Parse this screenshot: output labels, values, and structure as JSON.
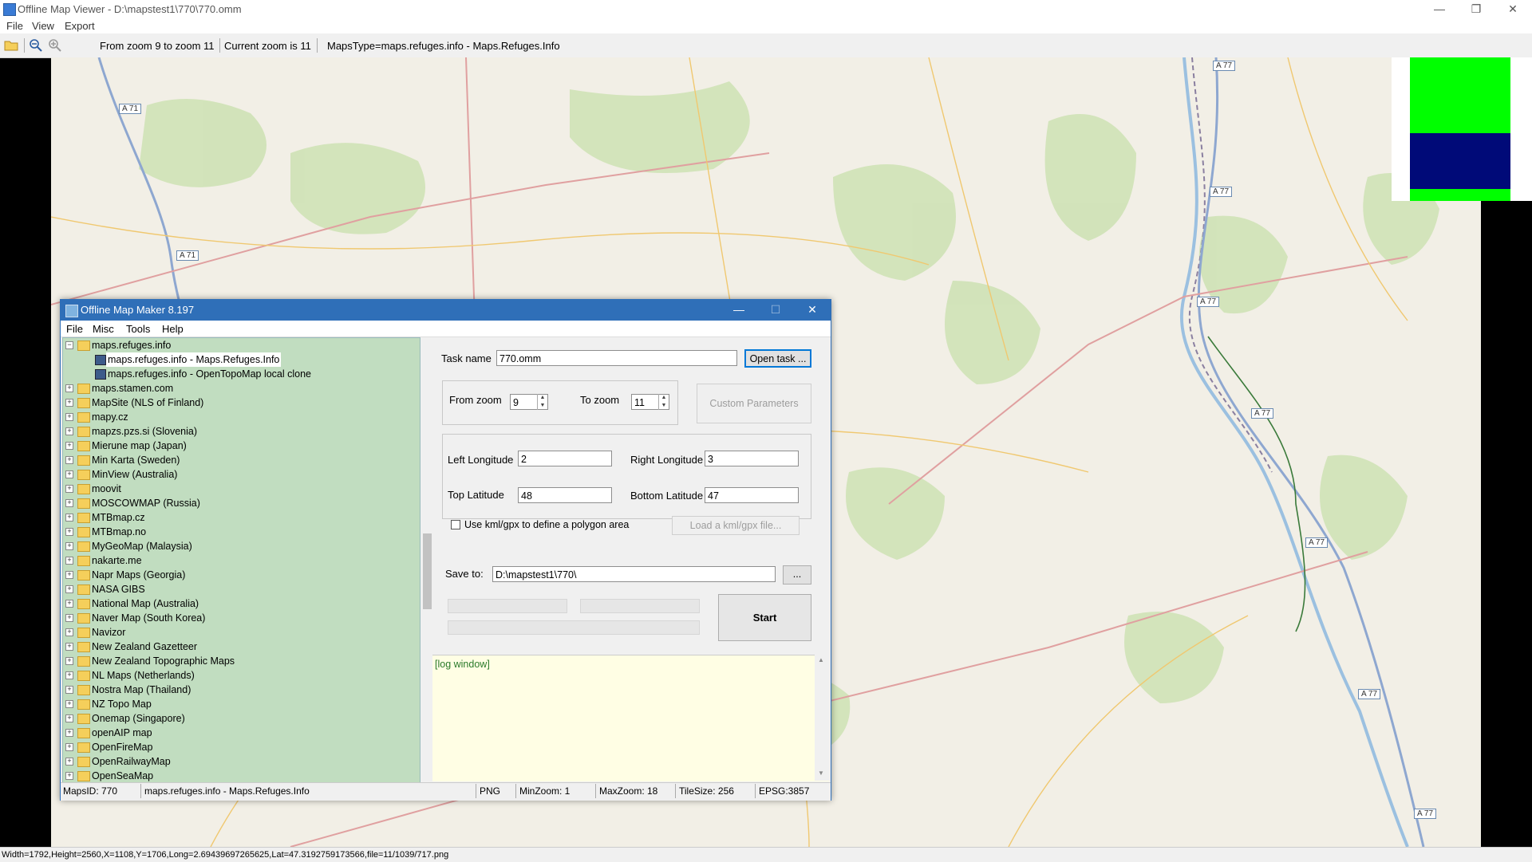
{
  "main_window": {
    "title": "Offline Map Viewer - D:\\mapstest1\\770\\770.omm",
    "controls": {
      "minimize": "—",
      "maximize": "❐",
      "close": "✕"
    }
  },
  "menu": {
    "file": "File",
    "view": "View",
    "export": "Export"
  },
  "toolbar": {
    "icons": [
      "open-folder-icon",
      "zoom-out-icon",
      "zoom-in-icon"
    ],
    "zoom_range": "From zoom 9 to zoom 11",
    "current_zoom": "Current zoom is 11",
    "maps_type": "MapsType=maps.refuges.info - Maps.Refuges.Info"
  },
  "map": {
    "road_labels": [
      "A 71",
      "A 71",
      "A 77",
      "A 77",
      "A 77",
      "A 77",
      "A 77",
      "A 77",
      "A 77"
    ],
    "legend_colors": [
      "#00ff00",
      "#000a78",
      "#00ff00"
    ]
  },
  "status_bar": {
    "text": "Width=1792,Height=2560,X=1108,Y=1706,Long=2.69439697265625,Lat=47.3192759173566,file=11/1039/717.png"
  },
  "dialog": {
    "title": "Offline Map Maker 8.197",
    "controls": {
      "minimize": "—",
      "maximize": "☐",
      "close": "✕"
    },
    "menu": {
      "file": "File",
      "misc": "Misc",
      "tools": "Tools",
      "help": "Help"
    },
    "tree": {
      "root": "maps.refuges.info",
      "children": [
        "maps.refuges.info - Maps.Refuges.Info",
        "maps.refuges.info - OpenTopoMap local clone"
      ],
      "selected_child": 0,
      "folders": [
        "maps.stamen.com",
        "MapSite (NLS of Finland)",
        "mapy.cz",
        "mapzs.pzs.si (Slovenia)",
        "Mierune map (Japan)",
        "Min Karta (Sweden)",
        "MinView (Australia)",
        "moovit",
        "MOSCOWMAP (Russia)",
        "MTBmap.cz",
        "MTBmap.no",
        "MyGeoMap (Malaysia)",
        "nakarte.me",
        "Napr Maps (Georgia)",
        "NASA GIBS",
        "National Map (Australia)",
        "Naver Map (South Korea)",
        "Navizor",
        "New Zealand Gazetteer",
        "New Zealand Topographic Maps",
        "NL Maps (Netherlands)",
        "Nostra Map (Thailand)",
        "NZ Topo Map",
        "Onemap (Singapore)",
        "openAIP map",
        "OpenFireMap",
        "OpenRailwayMap",
        "OpenSeaMap"
      ]
    },
    "task_name_label": "Task name",
    "task_name_value": "770.omm",
    "open_task_button": "Open task ...",
    "from_zoom_label": "From zoom",
    "from_zoom_value": "9",
    "to_zoom_label": "To zoom",
    "to_zoom_value": "11",
    "custom_parameters_button": "Custom Parameters",
    "left_longitude_label": "Left Longitude",
    "left_longitude_value": "2",
    "right_longitude_label": "Right Longitude",
    "right_longitude_value": "3",
    "top_latitude_label": "Top Latitude",
    "top_latitude_value": "48",
    "bottom_latitude_label": "Bottom Latitude",
    "bottom_latitude_value": "47",
    "kml_checkbox_label": "Use kml/gpx to define a polygon area",
    "kml_checked": false,
    "load_kml_button": "Load a kml/gpx file...",
    "save_to_label": "Save to:",
    "save_to_value": "D:\\mapstest1\\770\\",
    "browse_button": "...",
    "start_button": "Start",
    "log_text": "[log window]",
    "status": {
      "maps_id": "MapsID: 770",
      "maps_name": "maps.refuges.info - Maps.Refuges.Info",
      "format": "PNG",
      "min_zoom": "MinZoom: 1",
      "max_zoom": "MaxZoom: 18",
      "tile_size": "TileSize: 256",
      "epsg": "EPSG:3857"
    }
  }
}
